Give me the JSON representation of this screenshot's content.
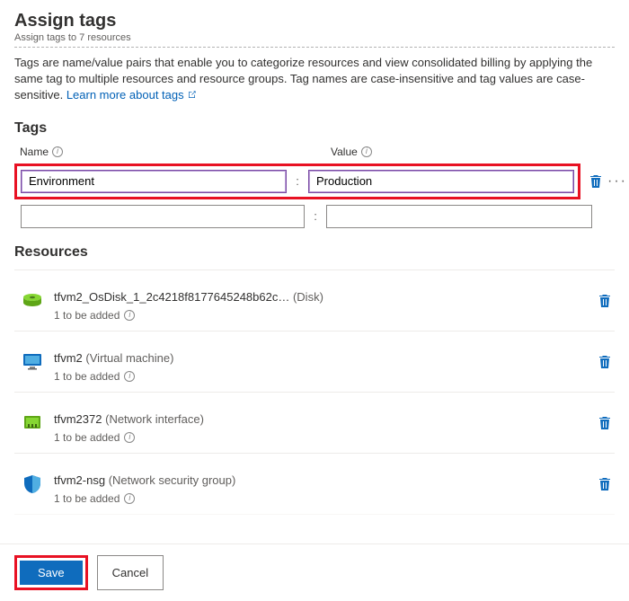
{
  "header": {
    "title": "Assign tags",
    "subtitle": "Assign tags to 7 resources",
    "description": "Tags are name/value pairs that enable you to categorize resources and view consolidated billing by applying the same tag to multiple resources and resource groups. Tag names are case-insensitive and tag values are case-sensitive. ",
    "learn_more": "Learn more about tags"
  },
  "tags": {
    "section_title": "Tags",
    "name_label": "Name",
    "value_label": "Value",
    "rows": [
      {
        "name": "Environment",
        "value": "Production"
      },
      {
        "name": "",
        "value": ""
      }
    ]
  },
  "resources": {
    "section_title": "Resources",
    "status_text": "1 to be added",
    "items": [
      {
        "name": "tfvm2_OsDisk_1_2c4218f8177645248b62c…",
        "type": "(Disk)",
        "icon": "disk"
      },
      {
        "name": "tfvm2",
        "type": "(Virtual machine)",
        "icon": "vm"
      },
      {
        "name": "tfvm2372",
        "type": "(Network interface)",
        "icon": "nic"
      },
      {
        "name": "tfvm2-nsg",
        "type": "(Network security group)",
        "icon": "nsg"
      }
    ]
  },
  "footer": {
    "save": "Save",
    "cancel": "Cancel"
  },
  "colors": {
    "primary": "#0f6cbd",
    "highlight": "#e81123",
    "link": "#0060b6"
  }
}
